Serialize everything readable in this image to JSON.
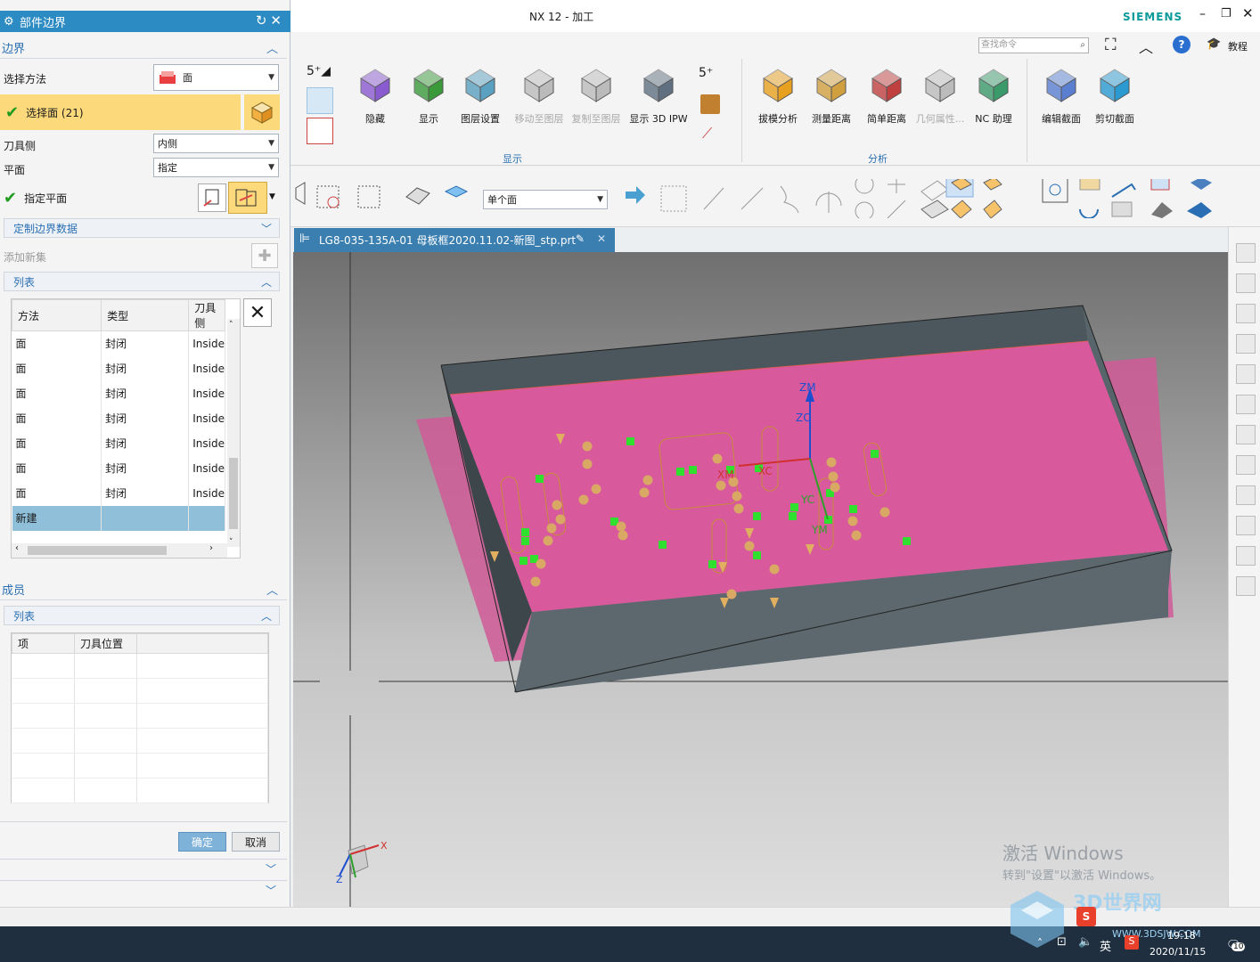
{
  "window": {
    "title": "NX 12 - 加工",
    "brand": "SIEMENS",
    "search_placeholder": "查找命令",
    "tutorial_label": "教程"
  },
  "dialog": {
    "title": "部件边界",
    "boundary_section": "边界",
    "select_method_label": "选择方法",
    "select_method_value": "面",
    "select_face_label": "选择面 (21)",
    "tool_side_label": "刀具侧",
    "tool_side_value": "内侧",
    "plane_label": "平面",
    "plane_value": "指定",
    "specify_plane_label": "指定平面",
    "custom_boundary_label": "定制边界数据",
    "add_new_set_label": "添加新集",
    "list_label": "列表",
    "list_columns": [
      "方法",
      "类型",
      "刀具侧"
    ],
    "list_rows": [
      [
        "面",
        "封闭",
        "Inside"
      ],
      [
        "面",
        "封闭",
        "Inside"
      ],
      [
        "面",
        "封闭",
        "Inside"
      ],
      [
        "面",
        "封闭",
        "Inside"
      ],
      [
        "面",
        "封闭",
        "Inside"
      ],
      [
        "面",
        "封闭",
        "Inside"
      ],
      [
        "面",
        "封闭",
        "Inside"
      ]
    ],
    "new_row_label": "新建",
    "members_section": "成员",
    "members_list_label": "列表",
    "members_columns": [
      "项",
      "刀具位置"
    ],
    "ok_label": "确定",
    "cancel_label": "取消"
  },
  "ribbon": {
    "buttons": [
      {
        "label": "隐藏",
        "disabled": false
      },
      {
        "label": "显示",
        "disabled": false
      },
      {
        "label": "图层设置",
        "disabled": false
      },
      {
        "label": "移动至图层",
        "disabled": true
      },
      {
        "label": "复制至图层",
        "disabled": true
      },
      {
        "label": "显示 3D IPW",
        "disabled": false
      },
      {
        "label": "拔模分析",
        "disabled": false
      },
      {
        "label": "测量距离",
        "disabled": false
      },
      {
        "label": "简单距离",
        "disabled": false
      },
      {
        "label": "几何属性...",
        "disabled": true
      },
      {
        "label": "NC 助理",
        "disabled": false
      },
      {
        "label": "编辑截面",
        "disabled": false
      },
      {
        "label": "剪切截面",
        "disabled": false
      }
    ],
    "group_display": "显示",
    "group_analysis": "分析",
    "selection_filter": "单个面"
  },
  "document": {
    "tab_title": "LG8-035-135A-01 母板框2020.11.02-新图_stp.prt"
  },
  "viewport": {
    "axis_labels": [
      "ZM",
      "ZC",
      "XM",
      "XC",
      "YC",
      "YM"
    ],
    "triad_labels": [
      "X",
      "Z"
    ],
    "watermark_title": "激活 Windows",
    "watermark_sub": "转到\"设置\"以激活 Windows。",
    "site_watermark": "3D世界网",
    "site_url": "WWW.3DSJW.COM"
  },
  "taskbar": {
    "time": "19:18",
    "date": "2020/11/15",
    "ime": "英",
    "notifications": "10"
  },
  "colors": {
    "accent": "#2c8bc3",
    "selection_yellow": "#fcd97a",
    "face_pink": "#d6589a",
    "wall_gray": "#505a5e"
  }
}
